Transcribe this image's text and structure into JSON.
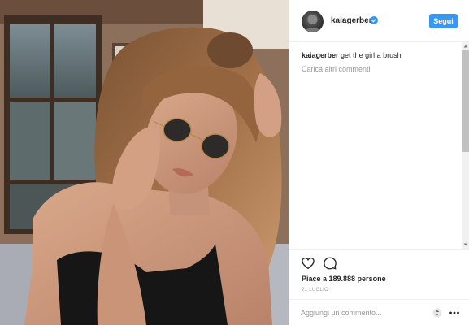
{
  "post": {
    "username": "kaiagerber",
    "follow_label": "Segui",
    "comment": {
      "user": "kaiagerber",
      "text": "get the girl a brush"
    },
    "load_more": "Carica altri commenti",
    "likes": "Piace a 189.888 persone",
    "date": "21 LUGLIO",
    "add_comment_placeholder": "Aggiungi un commento..."
  },
  "icons": {
    "verified": "verified-badge-icon",
    "like": "heart-outline-icon",
    "comment": "speech-bubble-icon",
    "more": "ellipsis-icon",
    "stepper": "up-down-arrows-icon"
  },
  "colors": {
    "accent": "#3897f0",
    "text": "#262626",
    "muted": "#999999",
    "divider": "#efefef"
  }
}
